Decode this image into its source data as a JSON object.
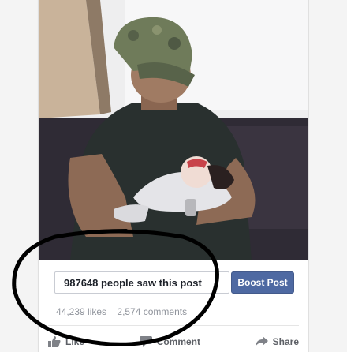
{
  "post": {
    "photo_alt": "",
    "reach_text": "987648 people saw this post",
    "boost_label": "Boost Post",
    "likes_text": "44,239 likes",
    "comments_text": "2,574 comments"
  },
  "actions": {
    "like_label": "Like",
    "comment_label": "Comment",
    "share_label": "Share"
  },
  "colors": {
    "boost_button": "#4e69a2",
    "annotation_ink": "#000000"
  }
}
